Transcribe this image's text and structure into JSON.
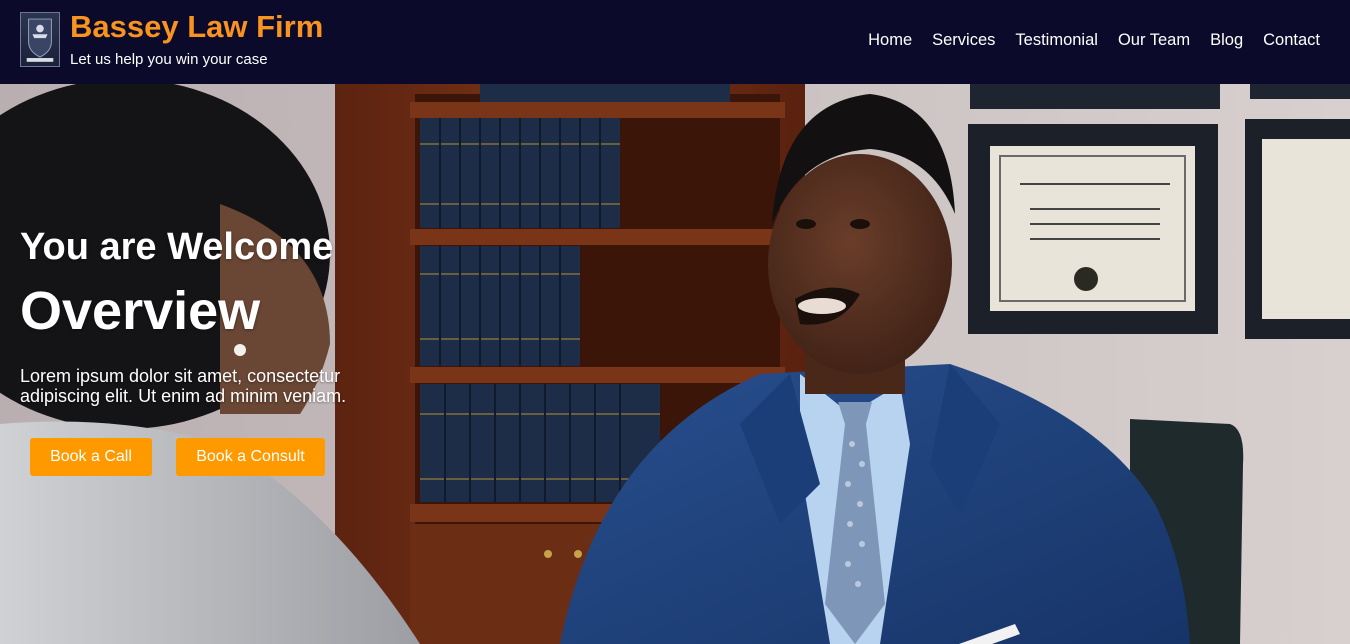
{
  "header": {
    "logo_icon": "law-firm-crest-icon",
    "brand_title": "Bassey Law Firm",
    "tagline": "Let us help you win your case",
    "nav": [
      {
        "label": "Home"
      },
      {
        "label": "Services"
      },
      {
        "label": "Testimonial"
      },
      {
        "label": "Our Team"
      },
      {
        "label": "Blog"
      },
      {
        "label": "Contact"
      }
    ]
  },
  "hero": {
    "welcome": "You are Welcome",
    "heading": "Overview",
    "lead": "Lorem ipsum dolor sit amet, consectetur adipiscing elit. Ut enim ad minim veniam.",
    "buttons": {
      "call": "Book a Call",
      "consult": "Book a Consult"
    }
  },
  "colors": {
    "header_bg": "#0b0a2b",
    "brand": "#f8931f",
    "button": "#ff9900",
    "text": "#ffffff"
  }
}
